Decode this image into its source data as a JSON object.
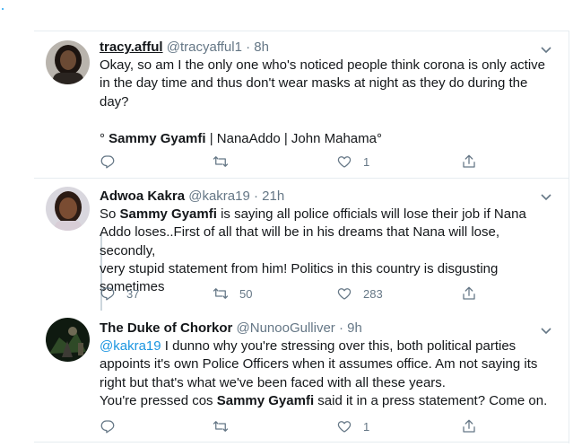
{
  "tweets": [
    {
      "name": "tracy.afful",
      "handle": "@tracyafful1",
      "time": "8h",
      "dotsep": "·",
      "lines": [
        {
          "segments": [
            {
              "t": "Okay, so am I the only one who's noticed people think corona is only active"
            }
          ]
        },
        {
          "segments": [
            {
              "t": "in the day time and thus don't wear masks at night as they do during the"
            }
          ]
        },
        {
          "segments": [
            {
              "t": "day?"
            }
          ]
        }
      ],
      "tagline": {
        "prefix": "° ",
        "bold": "Sammy Gyamfi",
        "rest": " | NanaAddo | John Mahama°"
      },
      "replies": "",
      "retweets": "",
      "likes": "1"
    },
    {
      "name": "Adwoa Kakra",
      "handle": "@kakra19",
      "time": "21h",
      "dotsep": "·",
      "lines": [
        {
          "segments": [
            {
              "t": "So "
            },
            {
              "t": "Sammy Gyamfi",
              "b": true
            },
            {
              "t": " is saying all police officials will lose their job if Nana"
            }
          ]
        },
        {
          "segments": [
            {
              "t": "Addo loses..First of all that will be in his dreams that Nana will lose, secondly,"
            }
          ]
        },
        {
          "segments": [
            {
              "t": "very stupid statement from him! Politics in this country is disgusting"
            }
          ]
        },
        {
          "segments": [
            {
              "t": "sometimes"
            }
          ]
        }
      ],
      "replies": "37",
      "retweets": "50",
      "likes": "283"
    },
    {
      "name": "The Duke of Chorkor",
      "handle": "@NunooGulliver",
      "time": "9h",
      "dotsep": "·",
      "lines": [
        {
          "segments": [
            {
              "t": "@kakra19",
              "m": true
            },
            {
              "t": " I dunno why you're stressing over this, both political parties"
            }
          ]
        },
        {
          "segments": [
            {
              "t": "appoints it's own Police Officers when it assumes office. Am not saying its"
            }
          ]
        },
        {
          "segments": [
            {
              "t": "right but that's what we've been faced with all these years."
            }
          ]
        },
        {
          "segments": [
            {
              "t": "You're pressed cos "
            },
            {
              "t": "Sammy Gyamfi",
              "b": true
            },
            {
              "t": " said it in a press statement? Come on."
            }
          ]
        }
      ],
      "replies": "",
      "retweets": "",
      "likes": "1"
    }
  ],
  "colors": {
    "accent": "#1b95e0",
    "muted": "#657786",
    "border": "#e6ecf0"
  },
  "icons": [
    "reply-icon",
    "retweet-icon",
    "like-icon",
    "share-icon",
    "caret-down-icon"
  ]
}
